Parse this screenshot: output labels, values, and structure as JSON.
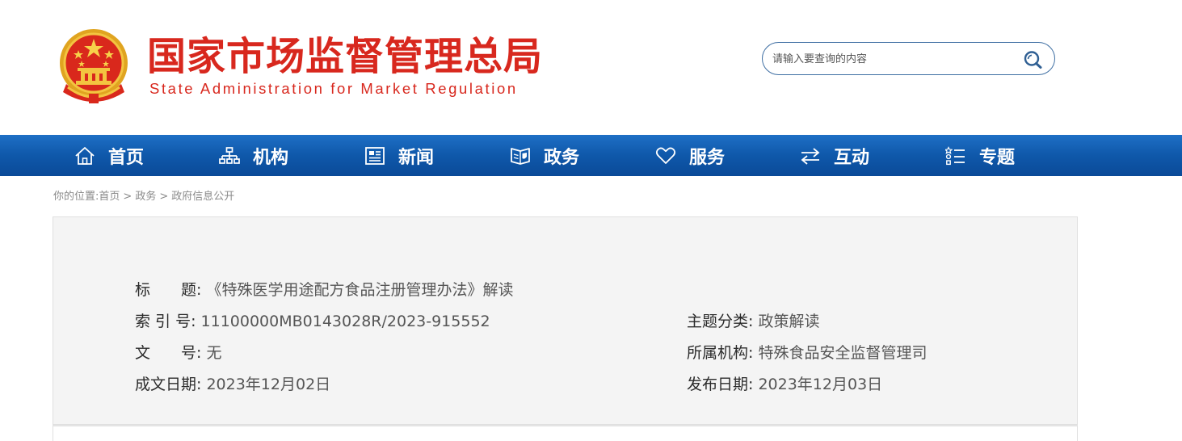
{
  "header": {
    "title_cn": "国家市场监督管理总局",
    "title_en": "State Administration for Market Regulation",
    "search": {
      "placeholder": "请输入要查询的内容"
    }
  },
  "colors": {
    "brand_red": "#d8281e",
    "nav_blue": "#0f58aa",
    "panel_bg": "#f4f4f4"
  },
  "nav": {
    "items": [
      {
        "label": "首页",
        "icon": "home-icon"
      },
      {
        "label": "机构",
        "icon": "org-chart-icon"
      },
      {
        "label": "新闻",
        "icon": "newspaper-icon"
      },
      {
        "label": "政务",
        "icon": "book-shield-icon"
      },
      {
        "label": "服务",
        "icon": "heart-icon"
      },
      {
        "label": "互动",
        "icon": "exchange-arrows-icon"
      },
      {
        "label": "专题",
        "icon": "list-icon"
      }
    ]
  },
  "breadcrumb": {
    "prefix": "你的位置:",
    "items": [
      "首页",
      "政务",
      "政府信息公开"
    ],
    "separator": ">"
  },
  "info": {
    "title": {
      "label": "标　　题:",
      "value": "《特殊医学用途配方食品注册管理办法》解读"
    },
    "index_no": {
      "label": "索 引 号:",
      "value": "11100000MB0143028R/2023-915552"
    },
    "category": {
      "label": "主题分类:",
      "value": "政策解读"
    },
    "doc_no": {
      "label": "文　　号:",
      "value": "无"
    },
    "agency": {
      "label": "所属机构:",
      "value": "特殊食品安全监督管理司"
    },
    "written_date": {
      "label": "成文日期:",
      "value": "2023年12月02日"
    },
    "publish_date": {
      "label": "发布日期:",
      "value": "2023年12月03日"
    }
  }
}
